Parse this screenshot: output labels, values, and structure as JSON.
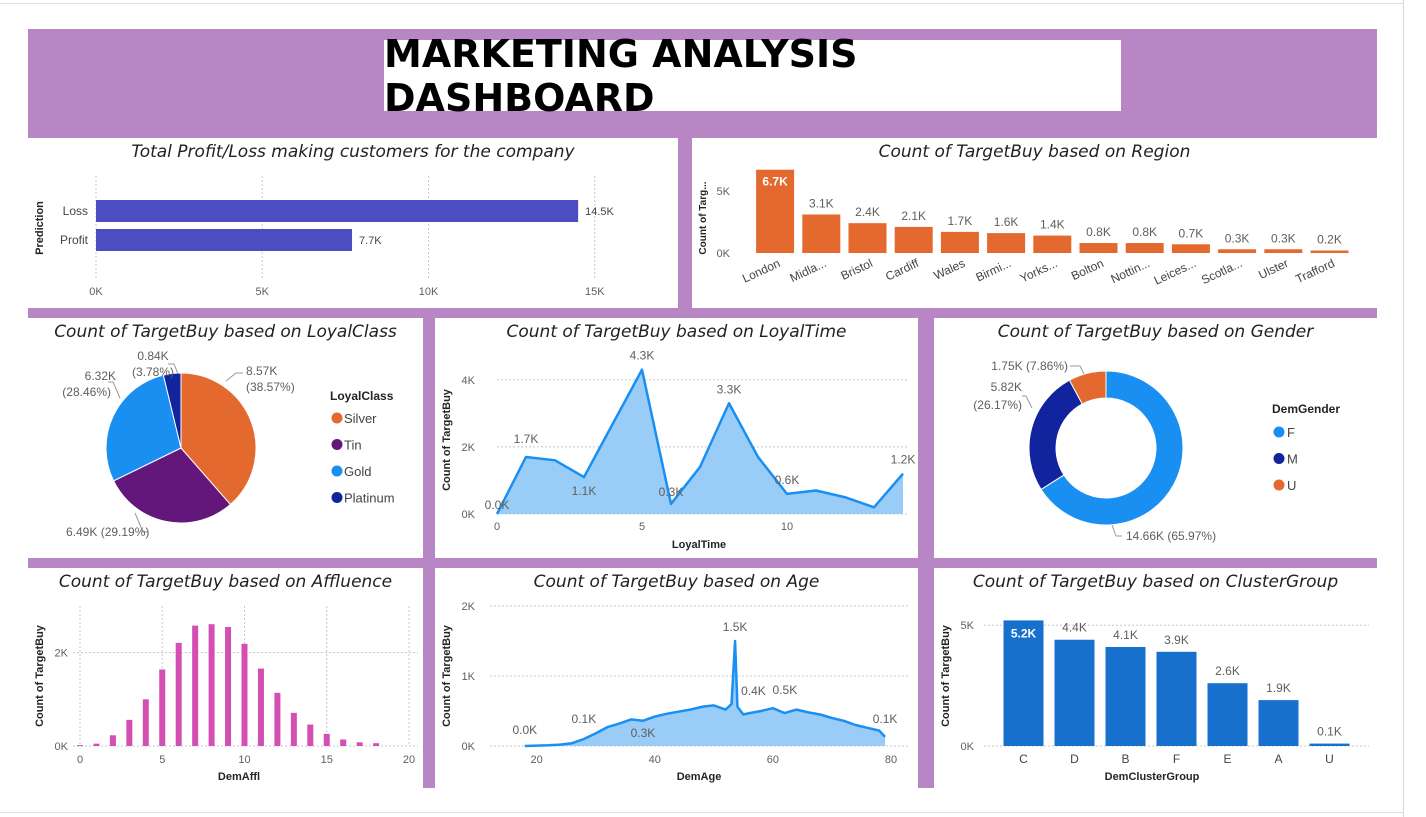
{
  "dashboard": {
    "title": "MARKETING ANALYSIS DASHBOARD"
  },
  "colors": {
    "background": "#b886c4",
    "orange": "#e3692e",
    "navy_bar": "#4b4dc0",
    "blue": "#1a8ff2",
    "light_blue": "#99cdf8",
    "pink": "#d44fb2",
    "cluster_blue": "#1670cc",
    "purple": "#63177a",
    "dark_navy": "#12239e"
  },
  "chart_data": [
    {
      "id": "profit",
      "type": "bar",
      "orientation": "horizontal",
      "title": "Total Profit/Loss making customers for the company",
      "ylabel": "Prediction",
      "categories": [
        "Loss",
        "Profit"
      ],
      "values": [
        14500,
        7700
      ],
      "data_labels": [
        "14.5K",
        "7.7K"
      ],
      "xticks": [
        0,
        5000,
        10000,
        15000
      ],
      "xtick_labels": [
        "0K",
        "5K",
        "10K",
        "15K"
      ],
      "xlim": [
        0,
        16000
      ],
      "grid": true
    },
    {
      "id": "region",
      "type": "bar",
      "title": "Count of TargetBuy based on Region",
      "ylabel": "Count of Targ...",
      "categories": [
        "London",
        "Midla...",
        "Bristol",
        "Cardiff",
        "Wales",
        "Birmi...",
        "Yorks...",
        "Bolton",
        "Nottin...",
        "Leices...",
        "Scotla...",
        "Ulster",
        "Trafford"
      ],
      "values": [
        6700,
        3100,
        2400,
        2100,
        1700,
        1600,
        1400,
        800,
        800,
        700,
        300,
        300,
        200
      ],
      "data_labels": [
        "6.7K",
        "3.1K",
        "2.4K",
        "2.1K",
        "1.7K",
        "1.6K",
        "1.4K",
        "0.8K",
        "0.8K",
        "0.7K",
        "0.3K",
        "0.3K",
        "0.2K"
      ],
      "yticks": [
        0,
        5000
      ],
      "ytick_labels": [
        "0K",
        "5K"
      ],
      "ylim": [
        0,
        7000
      ]
    },
    {
      "id": "loyalclass",
      "type": "pie",
      "title": "Count of TargetBuy based on LoyalClass",
      "legend_title": "LoyalClass",
      "legend_position": "right",
      "categories": [
        "Silver",
        "Tin",
        "Gold",
        "Platinum"
      ],
      "values": [
        8570,
        6490,
        6320,
        840
      ],
      "percent": [
        38.57,
        29.19,
        28.46,
        3.78
      ],
      "colors": [
        "#e3692e",
        "#63177a",
        "#1a8ff2",
        "#12239e"
      ],
      "data_labels": [
        "8.57K",
        "6.49K (29.19%)",
        "6.32K",
        "0.84K"
      ],
      "data_labels_pct": [
        "(38.57%)",
        "",
        "(28.46%)",
        "(3.78%)"
      ]
    },
    {
      "id": "loyaltime",
      "type": "area",
      "title": "Count of TargetBuy based on LoyalTime",
      "xlabel": "LoyalTime",
      "ylabel": "Count of TargetBuy",
      "x": [
        0,
        1,
        2,
        3,
        4,
        5,
        6,
        7,
        8,
        9,
        10,
        11,
        12,
        13,
        14
      ],
      "y": [
        0,
        1700,
        1600,
        1100,
        2700,
        4300,
        300,
        1400,
        3300,
        1700,
        600,
        700,
        500,
        200,
        1200
      ],
      "point_labels": [
        {
          "x": 0,
          "text": "0.0K"
        },
        {
          "x": 1,
          "text": "1.7K"
        },
        {
          "x": 3,
          "text": "1.1K"
        },
        {
          "x": 5,
          "text": "4.3K"
        },
        {
          "x": 6,
          "text": "0.3K"
        },
        {
          "x": 8,
          "text": "3.3K"
        },
        {
          "x": 10,
          "text": "0.6K"
        },
        {
          "x": 14,
          "text": "1.2K"
        }
      ],
      "xticks": [
        0,
        5,
        10
      ],
      "yticks": [
        0,
        2000,
        4000
      ],
      "ytick_labels": [
        "0K",
        "2K",
        "4K"
      ],
      "xlim": [
        0,
        14
      ],
      "ylim": [
        0,
        4500
      ],
      "grid": true
    },
    {
      "id": "gender",
      "type": "pie",
      "variant": "donut",
      "title": "Count of TargetBuy based on Gender",
      "legend_title": "DemGender",
      "legend_position": "right",
      "categories": [
        "F",
        "M",
        "U"
      ],
      "values": [
        14660,
        5820,
        1750
      ],
      "percent": [
        65.97,
        26.17,
        7.86
      ],
      "colors": [
        "#1a8ff2",
        "#12239e",
        "#e3692e"
      ],
      "data_labels": [
        "14.66K (65.97%)",
        "5.82K",
        "1.75K (7.86%)"
      ],
      "data_labels_pct": [
        "",
        "(26.17%)",
        ""
      ]
    },
    {
      "id": "affluence",
      "type": "bar",
      "title": "Count of TargetBuy based on Affluence",
      "xlabel": "DemAffl",
      "ylabel": "Count of TargetBuy",
      "x": [
        0,
        1,
        2,
        3,
        4,
        5,
        6,
        7,
        8,
        9,
        10,
        11,
        12,
        13,
        14,
        15,
        16,
        17,
        18
      ],
      "values": [
        20,
        50,
        230,
        560,
        1000,
        1640,
        2210,
        2580,
        2610,
        2550,
        2190,
        1660,
        1140,
        710,
        460,
        260,
        140,
        80,
        60
      ],
      "xticks": [
        0,
        5,
        10,
        15,
        20
      ],
      "yticks": [
        0,
        2000
      ],
      "ytick_labels": [
        "0K",
        "2K"
      ],
      "xlim": [
        -0.5,
        20
      ],
      "ylim": [
        0,
        3000
      ],
      "grid": true
    },
    {
      "id": "age",
      "type": "area",
      "title": "Count of TargetBuy based on Age",
      "xlabel": "DemAge",
      "ylabel": "Count of TargetBuy",
      "x": [
        18,
        20,
        22,
        24,
        26,
        28,
        30,
        32,
        34,
        36,
        38,
        40,
        42,
        44,
        46,
        48,
        50,
        52,
        53,
        53.6,
        54,
        55,
        56,
        58,
        60,
        62,
        64,
        66,
        68,
        70,
        72,
        74,
        76,
        78,
        79
      ],
      "y": [
        0,
        5,
        10,
        20,
        40,
        100,
        180,
        270,
        320,
        380,
        360,
        420,
        460,
        490,
        520,
        560,
        580,
        520,
        600,
        1500,
        560,
        450,
        470,
        500,
        540,
        470,
        520,
        480,
        450,
        400,
        360,
        300,
        260,
        220,
        130
      ],
      "point_labels": [
        {
          "x": 18,
          "text": "0.0K"
        },
        {
          "x": 28,
          "text": "0.1K"
        },
        {
          "x": 35,
          "text": "0.4K"
        },
        {
          "x": 38,
          "text": "0.3K"
        },
        {
          "x": 53.6,
          "text": "1.5K"
        },
        {
          "x": 54,
          "text": "0.4K"
        },
        {
          "x": 60,
          "text": "0.5K"
        },
        {
          "x": 79,
          "text": "0.1K"
        }
      ],
      "xticks": [
        20,
        40,
        60,
        80
      ],
      "yticks": [
        0,
        1000,
        2000
      ],
      "ytick_labels": [
        "0K",
        "1K",
        "2K"
      ],
      "xlim": [
        16,
        80
      ],
      "ylim": [
        0,
        2000
      ],
      "grid": true
    },
    {
      "id": "cluster",
      "type": "bar",
      "title": "Count of TargetBuy based on ClusterGroup",
      "xlabel": "DemClusterGroup",
      "ylabel": "Count of TargetBuy",
      "categories": [
        "C",
        "D",
        "B",
        "F",
        "E",
        "A",
        "U"
      ],
      "values": [
        5200,
        4400,
        4100,
        3900,
        2600,
        1900,
        100
      ],
      "data_labels": [
        "5.2K",
        "4.4K",
        "4.1K",
        "3.9K",
        "2.6K",
        "1.9K",
        "0.1K"
      ],
      "yticks": [
        0,
        5000
      ],
      "ytick_labels": [
        "0K",
        "5K"
      ],
      "ylim": [
        0,
        5300
      ],
      "grid": true
    }
  ]
}
